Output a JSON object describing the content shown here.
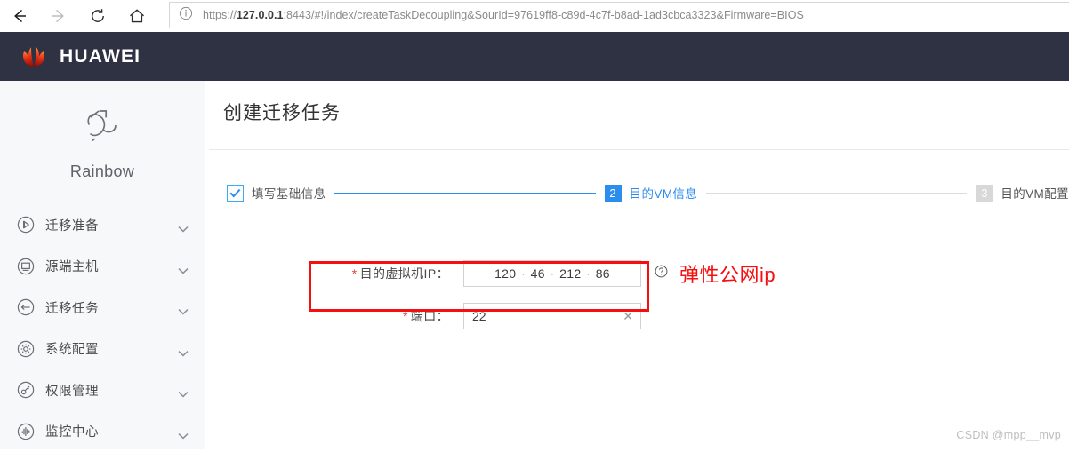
{
  "browser": {
    "back_icon": "arrow-left-icon",
    "forward_icon": "arrow-right-icon",
    "reload_icon": "reload-icon",
    "home_icon": "home-icon",
    "info_icon": "info-circle-icon",
    "url_scheme": "https://",
    "url_host": "127.0.0.1",
    "url_rest": ":8443/#!/index/createTaskDecoupling&SourId=97619ff8-c89d-4c7f-b8ad-1ad3cbca3323&Firmware=BIOS",
    "url_full": "https://127.0.0.1:8443/#!/index/createTaskDecoupling&SourId=97619ff8-c89d-4c7f-b8ad-1ad3cbca3323&Firmware=BIOS"
  },
  "header": {
    "brand": "HUAWEI",
    "logo_icon": "huawei-flower-logo",
    "background": "#2f3243"
  },
  "sidebar": {
    "product_name": "Rainbow",
    "product_icon": "rainbow-arrow-icon",
    "items": [
      {
        "label": "迁移准备",
        "icon": "play-circle-icon",
        "chevron": "chevron-down-icon"
      },
      {
        "label": "源端主机",
        "icon": "monitor-circle-icon",
        "chevron": "chevron-down-icon"
      },
      {
        "label": "迁移任务",
        "icon": "arrow-left-circle-icon",
        "chevron": "chevron-down-icon"
      },
      {
        "label": "系统配置",
        "icon": "gear-circle-icon",
        "chevron": "chevron-down-icon"
      },
      {
        "label": "权限管理",
        "icon": "key-circle-icon",
        "chevron": "chevron-down-icon"
      },
      {
        "label": "监控中心",
        "icon": "pulse-circle-icon",
        "chevron": "chevron-down-icon"
      }
    ]
  },
  "main": {
    "page_title": "创建迁移任务",
    "steps": [
      {
        "badge": "✓",
        "label": "填写基础信息",
        "state": "done"
      },
      {
        "badge": "2",
        "label": "目的VM信息",
        "state": "active"
      },
      {
        "badge": "3",
        "label": "目的VM配置",
        "state": "todo"
      }
    ],
    "form": {
      "ip_label": "目的虚拟机IP：",
      "ip_required": "*",
      "ip_octets": [
        "120",
        "46",
        "212",
        "86"
      ],
      "ip_separator": "·",
      "help_icon": "question-circle-icon",
      "port_label": "端口：",
      "port_required": "*",
      "port_value": "22",
      "port_clear_icon": "clear-x-icon"
    },
    "annotation": {
      "text": "弹性公网ip",
      "color": "#f60f0f"
    }
  },
  "watermark": "CSDN @mpp__mvp",
  "colors": {
    "accent_blue": "#2b8ded",
    "header_dark": "#2f3243",
    "sidebar_bg": "#f7f8fa",
    "annotation_red": "#f60f0f",
    "huawei_red": "#e8413c"
  }
}
